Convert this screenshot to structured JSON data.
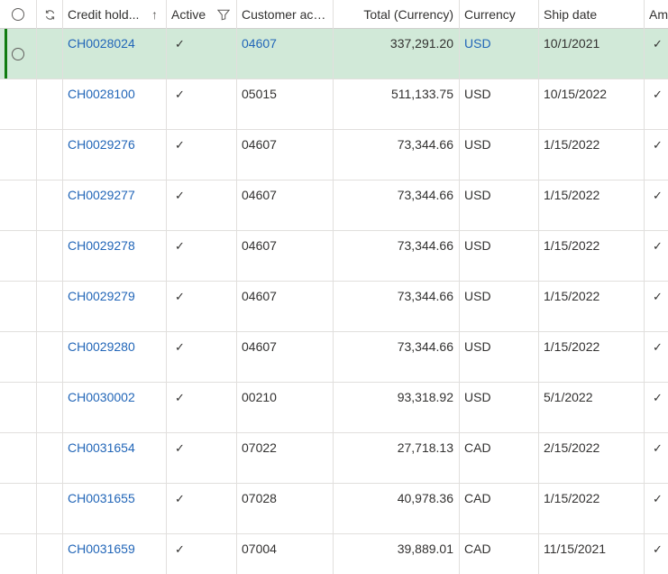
{
  "columns": {
    "credit_hold": "Credit hold...",
    "active": "Active",
    "customer_account": "Customer acc...",
    "total": "Total (Currency)",
    "currency": "Currency",
    "ship_date": "Ship date",
    "amount": "Am"
  },
  "icons": {
    "select_all": "radio-circle-icon",
    "refresh": "refresh-icon",
    "sort": "sort-ascending-icon",
    "filter": "filter-icon",
    "check": "checkmark-icon",
    "sort_glyph": "↑",
    "check_glyph": "✓"
  },
  "colors": {
    "link": "#2266b8",
    "selected_row": "#d1e9d8",
    "selected_accent": "#107c10"
  },
  "rows": [
    {
      "credit_hold": "CH0028024",
      "customer_account": "04607",
      "total": "337,291.20",
      "currency": "USD",
      "ship_date": "10/1/2021",
      "selected": true
    },
    {
      "credit_hold": "CH0028100",
      "customer_account": "05015",
      "total": "511,133.75",
      "currency": "USD",
      "ship_date": "10/15/2022",
      "selected": false
    },
    {
      "credit_hold": "CH0029276",
      "customer_account": "04607",
      "total": "73,344.66",
      "currency": "USD",
      "ship_date": "1/15/2022",
      "selected": false
    },
    {
      "credit_hold": "CH0029277",
      "customer_account": "04607",
      "total": "73,344.66",
      "currency": "USD",
      "ship_date": "1/15/2022",
      "selected": false
    },
    {
      "credit_hold": "CH0029278",
      "customer_account": "04607",
      "total": "73,344.66",
      "currency": "USD",
      "ship_date": "1/15/2022",
      "selected": false
    },
    {
      "credit_hold": "CH0029279",
      "customer_account": "04607",
      "total": "73,344.66",
      "currency": "USD",
      "ship_date": "1/15/2022",
      "selected": false
    },
    {
      "credit_hold": "CH0029280",
      "customer_account": "04607",
      "total": "73,344.66",
      "currency": "USD",
      "ship_date": "1/15/2022",
      "selected": false
    },
    {
      "credit_hold": "CH0030002",
      "customer_account": "00210",
      "total": "93,318.92",
      "currency": "USD",
      "ship_date": "5/1/2022",
      "selected": false
    },
    {
      "credit_hold": "CH0031654",
      "customer_account": "07022",
      "total": "27,718.13",
      "currency": "CAD",
      "ship_date": "2/15/2022",
      "selected": false
    },
    {
      "credit_hold": "CH0031655",
      "customer_account": "07028",
      "total": "40,978.36",
      "currency": "CAD",
      "ship_date": "1/15/2022",
      "selected": false
    },
    {
      "credit_hold": "CH0031659",
      "customer_account": "07004",
      "total": "39,889.01",
      "currency": "CAD",
      "ship_date": "11/15/2021",
      "selected": false
    }
  ]
}
